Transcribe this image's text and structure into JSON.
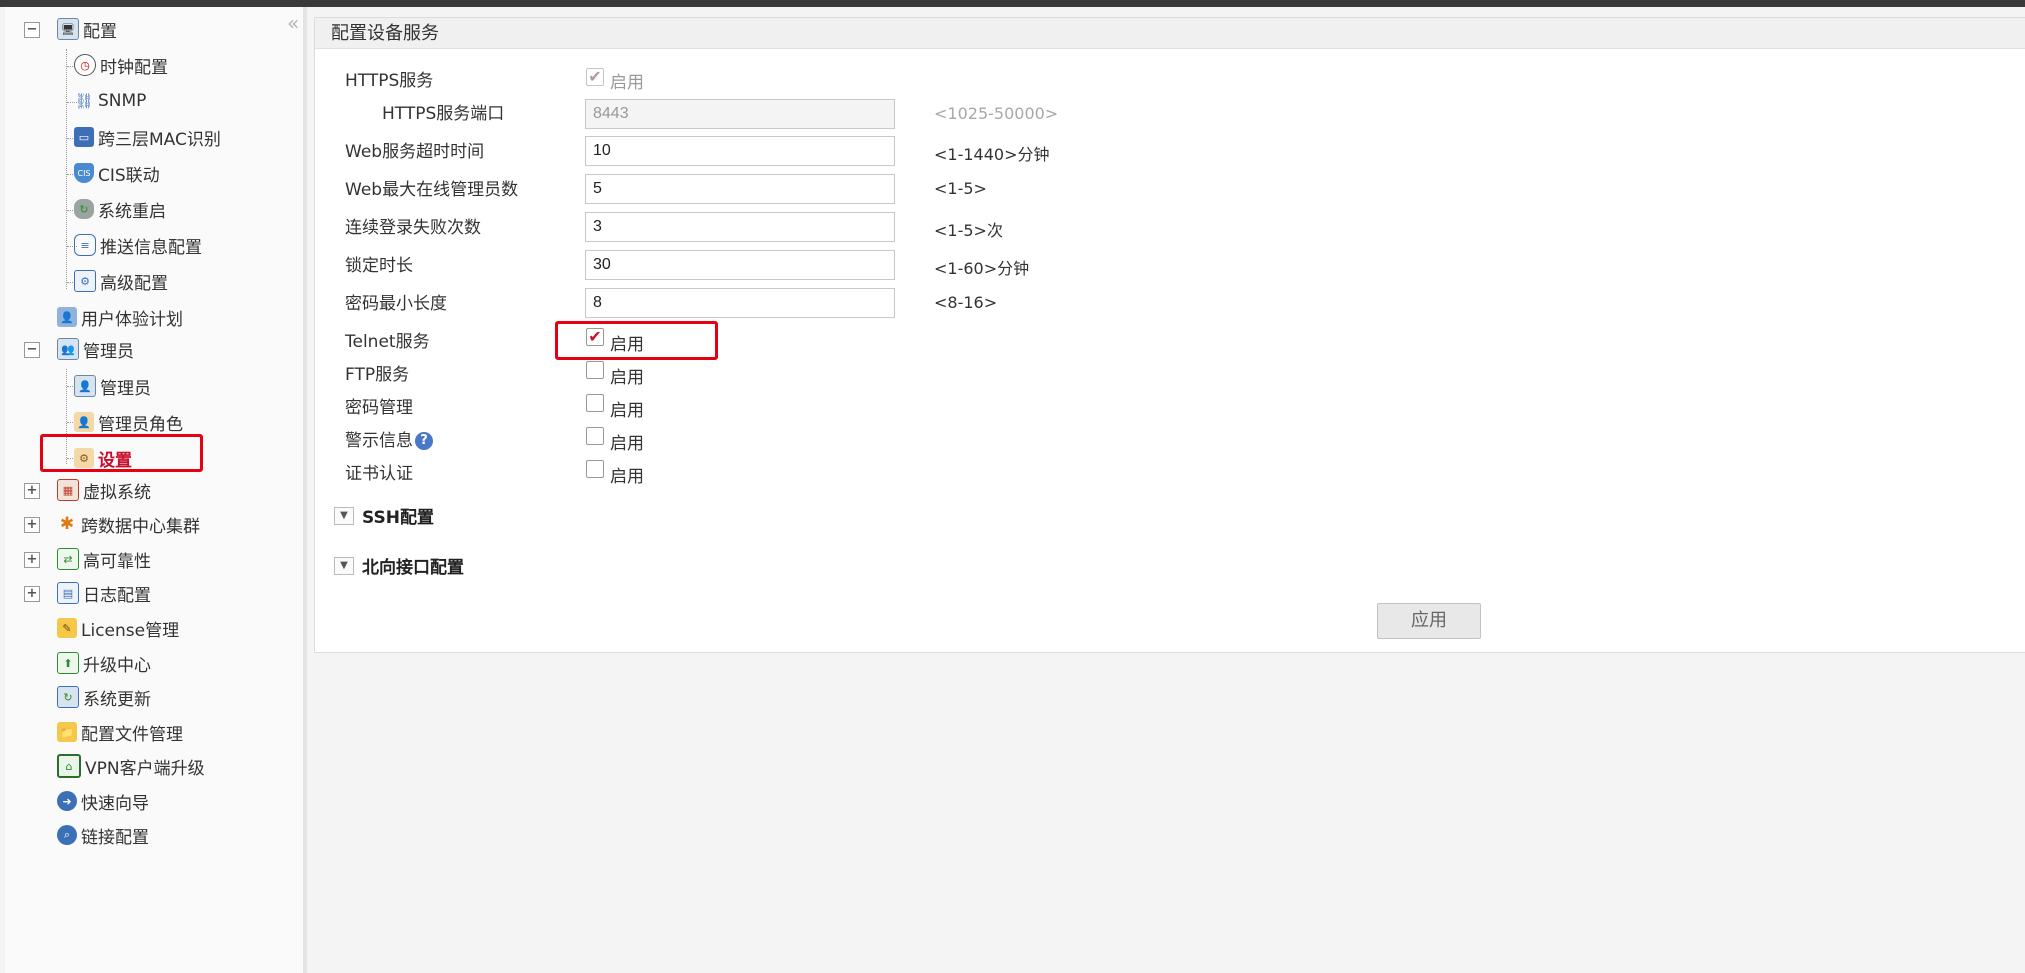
{
  "sidebar": {
    "collapse_glyph": "«",
    "items": [
      {
        "label": "配置",
        "icon": "monitor-gear-icon",
        "level": 0,
        "expander": "−"
      },
      {
        "label": "时钟配置",
        "icon": "clock-icon",
        "level": 1
      },
      {
        "label": "SNMP",
        "icon": "network-icon",
        "level": 1
      },
      {
        "label": "跨三层MAC识别",
        "icon": "mac-monitor-icon",
        "level": 1
      },
      {
        "label": "CIS联动",
        "icon": "cis-shield-icon",
        "level": 1
      },
      {
        "label": "系统重启",
        "icon": "restart-icon",
        "level": 1
      },
      {
        "label": "推送信息配置",
        "icon": "message-icon",
        "level": 1
      },
      {
        "label": "高级配置",
        "icon": "advanced-config-icon",
        "level": 1
      },
      {
        "label": "用户体验计划",
        "icon": "user-experience-icon",
        "level": 0
      },
      {
        "label": "管理员",
        "icon": "admin-group-icon",
        "level": 0,
        "expander": "−"
      },
      {
        "label": "管理员",
        "icon": "admin-icon",
        "level": 1
      },
      {
        "label": "管理员角色",
        "icon": "admin-role-icon",
        "level": 1
      },
      {
        "label": "设置",
        "icon": "admin-settings-icon",
        "level": 1,
        "selected": true
      },
      {
        "label": "虚拟系统",
        "icon": "virtual-system-icon",
        "level": 0,
        "expander": "+"
      },
      {
        "label": "跨数据中心集群",
        "icon": "cluster-icon",
        "level": 0,
        "expander": "+"
      },
      {
        "label": "高可靠性",
        "icon": "high-availability-icon",
        "level": 0,
        "expander": "+"
      },
      {
        "label": "日志配置",
        "icon": "log-config-icon",
        "level": 0,
        "expander": "+"
      },
      {
        "label": "License管理",
        "icon": "license-icon",
        "level": 0
      },
      {
        "label": "升级中心",
        "icon": "upgrade-center-icon",
        "level": 0
      },
      {
        "label": "系统更新",
        "icon": "system-update-icon",
        "level": 0
      },
      {
        "label": "配置文件管理",
        "icon": "config-file-icon",
        "level": 0
      },
      {
        "label": "VPN客户端升级",
        "icon": "vpn-client-icon",
        "level": 0
      },
      {
        "label": "快速向导",
        "icon": "quick-wizard-icon",
        "level": 0
      },
      {
        "label": "链接配置",
        "icon": "link-config-icon",
        "level": 0
      }
    ]
  },
  "main": {
    "title": "配置设备服务",
    "https": {
      "label": "HTTPS服务",
      "checkbox_label": "启用",
      "checked": true
    },
    "https_port": {
      "label": "HTTPS服务端口",
      "value": "8443",
      "hint": "<1025-50000>"
    },
    "web_timeout": {
      "label": "Web服务超时时间",
      "value": "10",
      "hint": "<1-1440>分钟"
    },
    "web_max_admins": {
      "label": "Web最大在线管理员数",
      "value": "5",
      "hint": "<1-5>"
    },
    "login_failures": {
      "label": "连续登录失败次数",
      "value": "3",
      "hint": "<1-5>次"
    },
    "lock_duration": {
      "label": "锁定时长",
      "value": "30",
      "hint": "<1-60>分钟"
    },
    "pwd_min_length": {
      "label": "密码最小长度",
      "value": "8",
      "hint": "<8-16>"
    },
    "telnet": {
      "label": "Telnet服务",
      "checkbox_label": "启用",
      "checked": true
    },
    "ftp": {
      "label": "FTP服务",
      "checkbox_label": "启用",
      "checked": false
    },
    "pwd_mgmt": {
      "label": "密码管理",
      "checkbox_label": "启用",
      "checked": false
    },
    "warning_info": {
      "label": "警示信息",
      "help_glyph": "?",
      "checkbox_label": "启用",
      "checked": false
    },
    "cert_auth": {
      "label": "证书认证",
      "checkbox_label": "启用",
      "checked": false
    },
    "ssh_section": "SSH配置",
    "northbound_section": "北向接口配置",
    "apply_label": "应用",
    "check_glyph": "✔",
    "triangle_glyph": "▼"
  },
  "colors": {
    "highlight": "#e60012",
    "check": "#c8102e"
  }
}
